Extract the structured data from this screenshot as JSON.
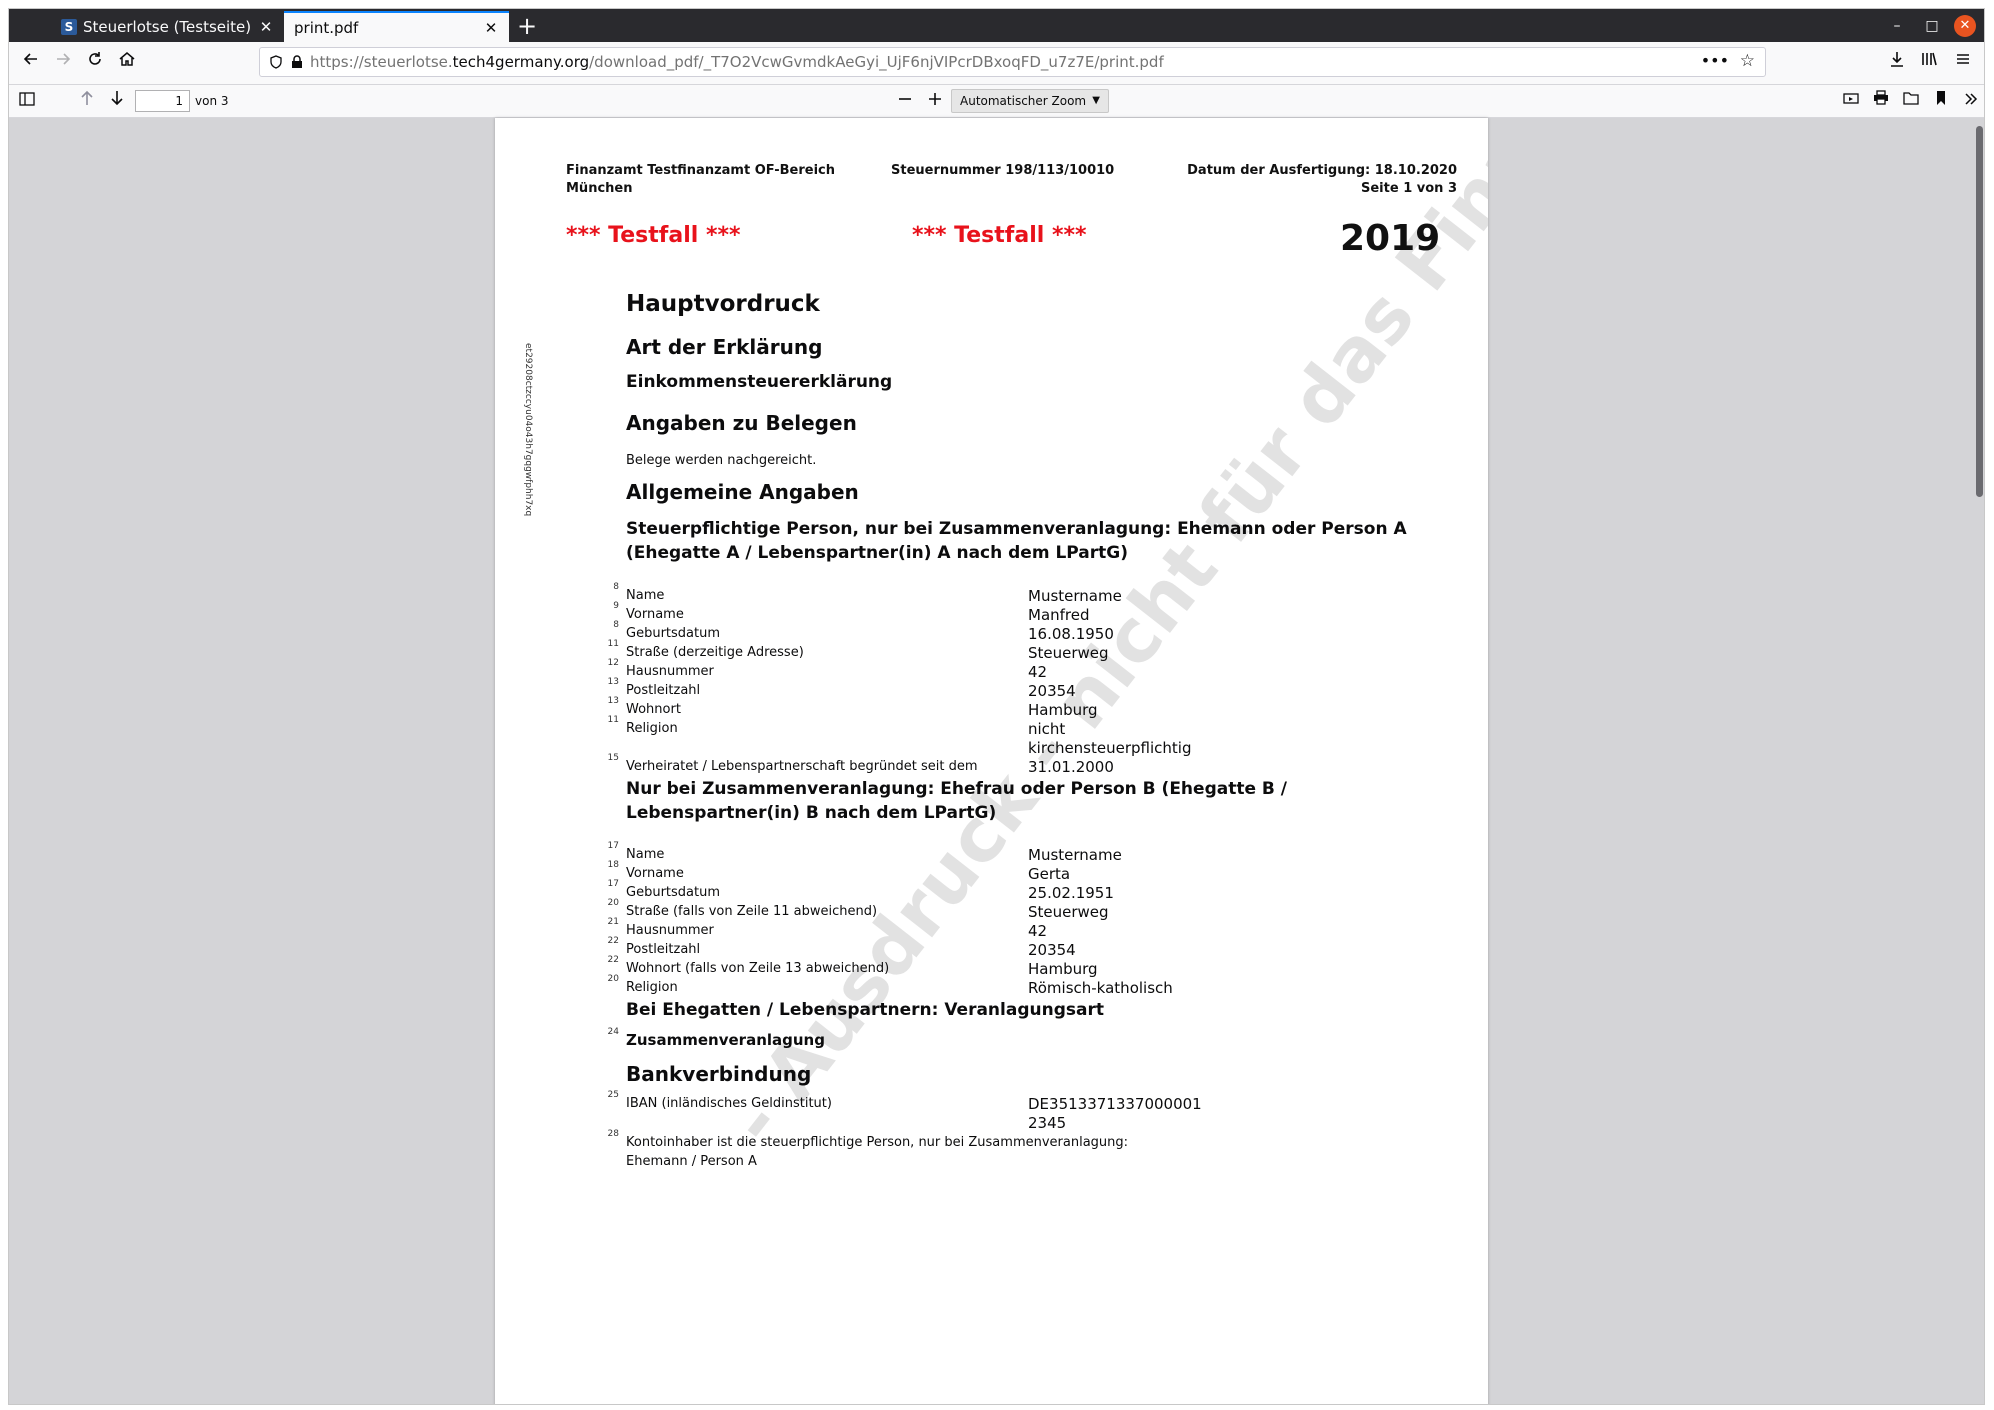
{
  "browser": {
    "tabs": [
      {
        "title": "Steuerlotse (Testseite)",
        "favicon": "S"
      },
      {
        "title": "print.pdf"
      }
    ],
    "url_prefix": "https://steuerlotse.",
    "url_host": "tech4germany.org",
    "url_path": "/download_pdf/_T7O2VcwGvmdkAeGyi_UjF6njVIPcrDBxoqFD_u7z7E/print.pdf",
    "window_controls": {
      "minimize": "–",
      "maximize": "□",
      "close": "✕"
    }
  },
  "pdf_toolbar": {
    "page_number": "1",
    "page_count": "von 3",
    "zoom": "Automatischer Zoom"
  },
  "document": {
    "office_line1": "Finanzamt Testfinanzamt OF-Bereich",
    "office_line2": "München",
    "tax_number": "Steuernummer 198/113/10010",
    "date": "Datum der Ausfertigung: 18.10.2020",
    "page_info": "Seite 1 von 3",
    "testfall_1": "*** Testfall ***",
    "testfall_2": "*** Testfall ***",
    "year": "2019",
    "side_code": "et29208ctzccyu04o43h7gqgwfphh7xq",
    "watermark": "- Ausdruck - nicht für das Finanzamt -",
    "title": "Hauptvordruck",
    "art_heading": "Art der Erklärung",
    "art_value": "Einkommensteuererklärung",
    "belege_heading": "Angaben zu Belegen",
    "belege_text": "Belege werden nachgereicht.",
    "allgemein_heading": "Allgemeine Angaben",
    "person_a_heading": "Steuerpflichtige Person, nur bei Zusammenveranlagung: Ehemann oder Person A (Ehegatte A / Lebenspartner(in) A nach dem LPartG)",
    "person_a": [
      {
        "no": "8",
        "label": "Name",
        "value": "Mustername"
      },
      {
        "no": "9",
        "label": "Vorname",
        "value": "Manfred"
      },
      {
        "no": "8",
        "label": "Geburtsdatum",
        "value": "16.08.1950"
      },
      {
        "no": "11",
        "label": "Straße (derzeitige Adresse)",
        "value": "Steuerweg"
      },
      {
        "no": "12",
        "label": "Hausnummer",
        "value": "42"
      },
      {
        "no": "13",
        "label": "Postleitzahl",
        "value": "20354"
      },
      {
        "no": "13",
        "label": "Wohnort",
        "value": "Hamburg"
      },
      {
        "no": "11",
        "label": "Religion",
        "value": "nicht kirchensteuerpflichtig"
      },
      {
        "no": "15",
        "label": "Verheiratet / Lebenspartnerschaft begründet seit dem",
        "value": "31.01.2000"
      }
    ],
    "person_b_heading": "Nur bei Zusammenveranlagung: Ehefrau oder Person B (Ehegatte B / Lebenspartner(in) B nach dem LPartG)",
    "person_b": [
      {
        "no": "17",
        "label": "Name",
        "value": "Mustername"
      },
      {
        "no": "18",
        "label": "Vorname",
        "value": "Gerta"
      },
      {
        "no": "17",
        "label": "Geburtsdatum",
        "value": "25.02.1951"
      },
      {
        "no": "20",
        "label": "Straße (falls von Zeile 11 abweichend)",
        "value": "Steuerweg"
      },
      {
        "no": "21",
        "label": "Hausnummer",
        "value": "42"
      },
      {
        "no": "22",
        "label": "Postleitzahl",
        "value": "20354"
      },
      {
        "no": "22",
        "label": "Wohnort (falls von Zeile 13 abweichend)",
        "value": "Hamburg"
      },
      {
        "no": "20",
        "label": "Religion",
        "value": "Römisch-katholisch"
      }
    ],
    "veranlagung_heading": "Bei Ehegatten / Lebenspartnern: Veranlagungsart",
    "veranlagung_no": "24",
    "veranlagung_value": "Zusammenveranlagung",
    "bank_heading": "Bankverbindung",
    "bank": [
      {
        "no": "25",
        "label": "IBAN (inländisches Geldinstitut)",
        "value": "DE35133713370000012345"
      },
      {
        "no": "28",
        "label": "Kontoinhaber ist die steuerpflichtige Person, nur bei Zusammenveranlagung: Ehemann / Person A",
        "value": ""
      }
    ]
  }
}
